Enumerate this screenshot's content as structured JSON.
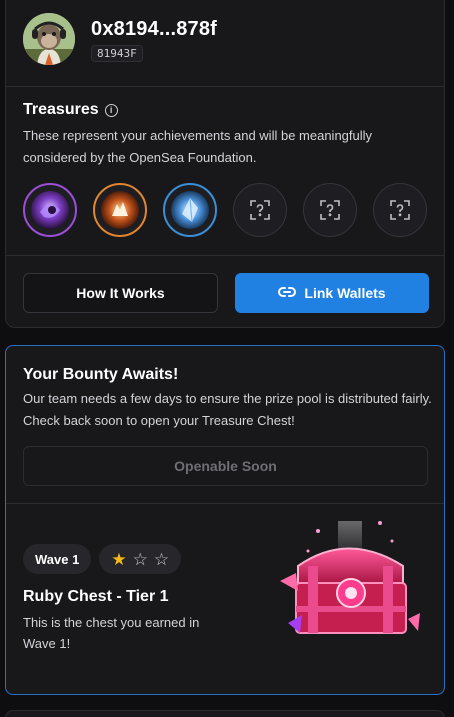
{
  "profile": {
    "address": "0x8194...878f",
    "tag": "81943F",
    "avatar_icon": "monkey-avatar-icon"
  },
  "treasures": {
    "title": "Treasures",
    "description": "These represent your achievements and will be meaningfully considered by the OpenSea Foundation.",
    "badges": [
      {
        "name": "purple-shell-badge",
        "state": "earned",
        "color": "#9b4fd6"
      },
      {
        "name": "orange-flame-badge",
        "state": "earned",
        "color": "#e0862e"
      },
      {
        "name": "blue-crystal-badge",
        "state": "earned",
        "color": "#3a8fd6"
      },
      {
        "name": "locked-badge",
        "state": "locked"
      },
      {
        "name": "locked-badge",
        "state": "locked"
      },
      {
        "name": "locked-badge",
        "state": "locked"
      }
    ]
  },
  "actions": {
    "how_it_works": "How It Works",
    "link_wallets": "Link Wallets"
  },
  "bounty": {
    "title": "Your Bounty Awaits!",
    "description": "Our team needs a few days to ensure the prize pool is distributed fairly. Check back soon to open your Treasure Chest!",
    "button": "Openable Soon"
  },
  "chest": {
    "wave_label": "Wave 1",
    "stars_filled": 1,
    "stars_total": 3,
    "title": "Ruby Chest - Tier 1",
    "description": "This is the chest you earned in Wave 1!",
    "icon": "ruby-chest-icon"
  },
  "colors": {
    "accent": "#2081e2",
    "card_border_highlight": "#2a6fc4",
    "star": "#f5b919",
    "background": "#0e0e10",
    "card": "#18181b"
  }
}
